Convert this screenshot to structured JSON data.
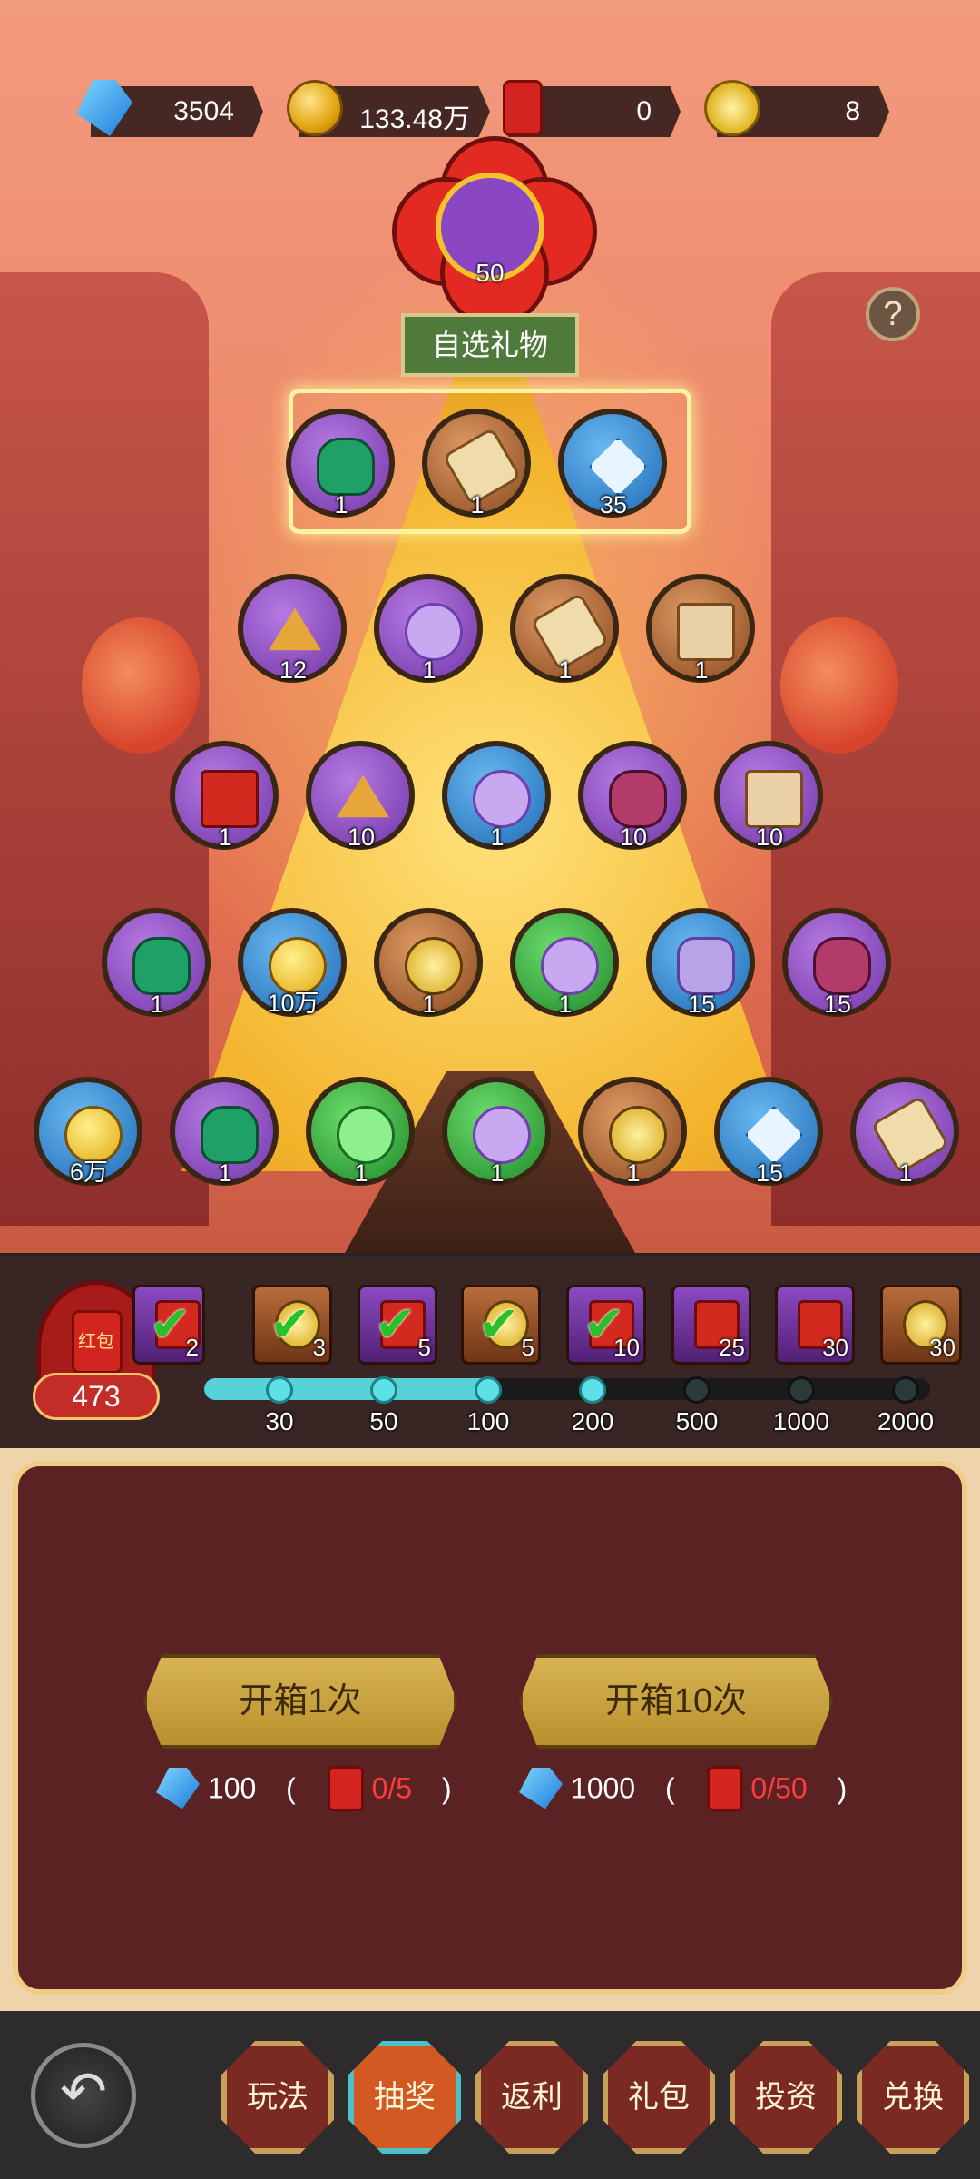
{
  "currencies": [
    {
      "icon": "diamond-icon",
      "value": "3504"
    },
    {
      "icon": "gold-coin-icon",
      "value": "133.48万"
    },
    {
      "icon": "red-envelope-icon",
      "value": "0"
    },
    {
      "icon": "gold-ingot-icon",
      "value": "8"
    }
  ],
  "grand_prize": {
    "count": "50",
    "button": "自选礼物"
  },
  "help_label": "?",
  "rows": [
    [
      {
        "type": "purple",
        "icon": "jade-bag",
        "count": "1"
      },
      {
        "type": "brown",
        "icon": "scroll",
        "count": "1"
      },
      {
        "type": "blue",
        "icon": "crystal",
        "count": "35"
      }
    ],
    [
      {
        "type": "purple",
        "icon": "gold-sand",
        "count": "12"
      },
      {
        "type": "purple",
        "icon": "fu-token",
        "count": "1"
      },
      {
        "type": "brown",
        "icon": "scroll",
        "count": "1"
      },
      {
        "type": "brown",
        "icon": "map",
        "count": "1"
      }
    ],
    [
      {
        "type": "purple",
        "icon": "red-envelope",
        "count": "1"
      },
      {
        "type": "purple",
        "icon": "gold-sand",
        "count": "10"
      },
      {
        "type": "blue",
        "icon": "fu-token",
        "count": "1"
      },
      {
        "type": "purple",
        "icon": "dragon-stone",
        "count": "10"
      },
      {
        "type": "purple",
        "icon": "banner",
        "count": "10"
      }
    ],
    [
      {
        "type": "purple",
        "icon": "jade-bag",
        "count": "1"
      },
      {
        "type": "blue",
        "icon": "gold-coin",
        "count": "10万"
      },
      {
        "type": "brown",
        "icon": "gold-ingot",
        "count": "1"
      },
      {
        "type": "green",
        "icon": "fu-token",
        "count": "1"
      },
      {
        "type": "blue",
        "icon": "purple-gem",
        "count": "15"
      },
      {
        "type": "purple",
        "icon": "dragon-stone",
        "count": "15"
      }
    ],
    [
      {
        "type": "blue",
        "icon": "gold-coin",
        "count": "6万"
      },
      {
        "type": "purple",
        "icon": "jade-bag",
        "count": "1"
      },
      {
        "type": "green",
        "icon": "jade-disc",
        "count": "1"
      },
      {
        "type": "green",
        "icon": "fu-token",
        "count": "1"
      },
      {
        "type": "brown",
        "icon": "gold-ingot",
        "count": "1"
      },
      {
        "type": "blue",
        "icon": "crystal",
        "count": "15"
      },
      {
        "type": "purple",
        "icon": "scroll",
        "count": "1"
      }
    ]
  ],
  "red_envelope_total": {
    "label": "红包",
    "count": "473"
  },
  "progress": {
    "filled_fraction": 0.4,
    "tiers": [
      {
        "type": "p",
        "icon": "red-envelope",
        "value": "2",
        "claimed": true
      },
      {
        "type": "b",
        "icon": "gold-ingot",
        "value": "3",
        "claimed": true
      },
      {
        "type": "p",
        "icon": "red-envelope",
        "value": "5",
        "claimed": true
      },
      {
        "type": "b",
        "icon": "gold-ingot",
        "value": "5",
        "claimed": true
      },
      {
        "type": "p",
        "icon": "red-envelope",
        "value": "10",
        "claimed": true
      },
      {
        "type": "p",
        "icon": "red-envelope",
        "value": "25",
        "claimed": false
      },
      {
        "type": "p",
        "icon": "red-envelope",
        "value": "30",
        "claimed": false
      },
      {
        "type": "b",
        "icon": "gold-ingot",
        "value": "30",
        "claimed": false
      }
    ],
    "milestones": [
      "30",
      "50",
      "100",
      "200",
      "500",
      "1000",
      "2000"
    ],
    "reached": [
      true,
      true,
      true,
      true,
      false,
      false,
      false
    ]
  },
  "draw": [
    {
      "label": "开箱1次",
      "gem_cost": "100",
      "open_paren": "(",
      "rp_progress": "0/5",
      "close_paren": ")"
    },
    {
      "label": "开箱10次",
      "gem_cost": "1000",
      "open_paren": "(",
      "rp_progress": "0/50",
      "close_paren": ")"
    }
  ],
  "nav": {
    "back_glyph": "↶",
    "items": [
      {
        "label": "玩法",
        "active": false
      },
      {
        "label": "抽奖",
        "active": true
      },
      {
        "label": "返利",
        "active": false
      },
      {
        "label": "礼包",
        "active": false
      },
      {
        "label": "投资",
        "active": false
      },
      {
        "label": "兑换",
        "active": false
      }
    ]
  }
}
